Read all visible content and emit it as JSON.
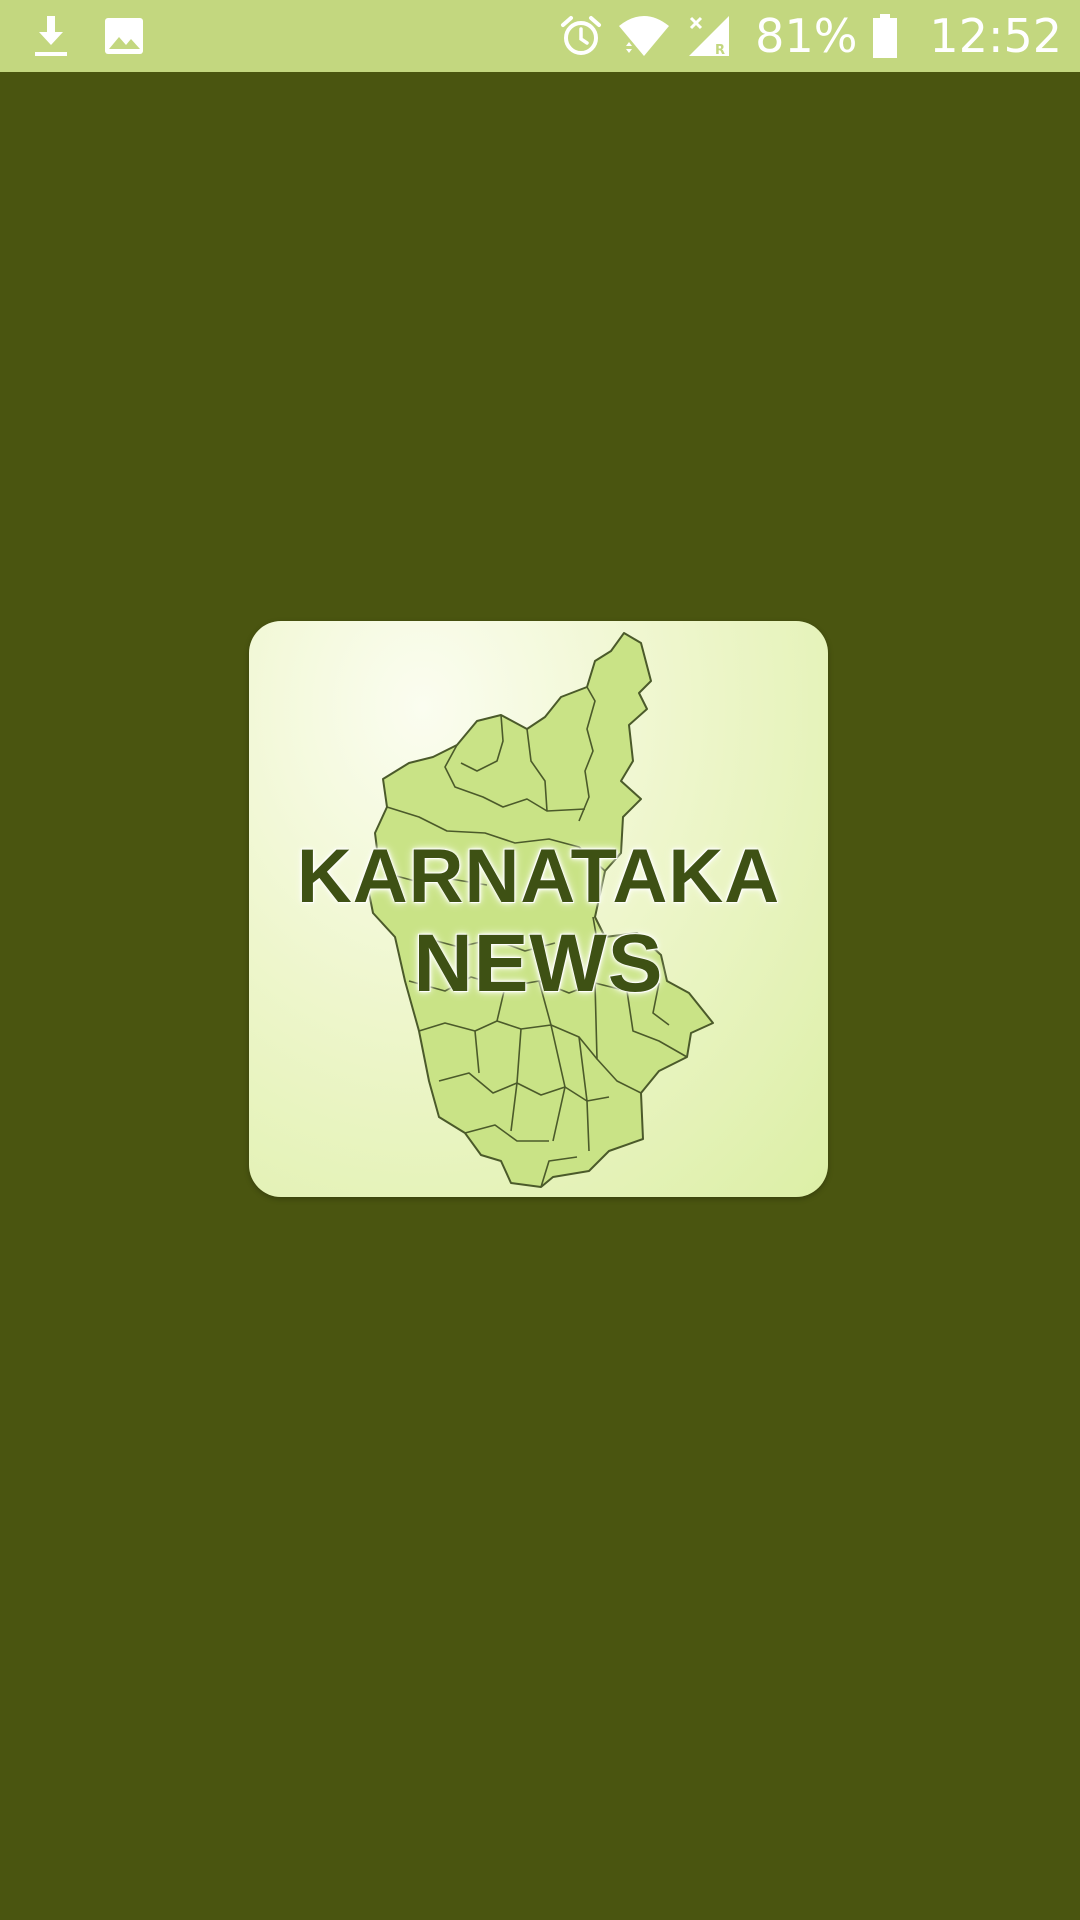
{
  "status_bar": {
    "left_icons": [
      "download-icon",
      "image-icon"
    ],
    "right_icons": [
      "alarm-icon",
      "wifi-icon",
      "signal-roaming-icon",
      "battery-icon"
    ],
    "battery_percent": "81%",
    "time": "12:52",
    "background": "#c3d77f"
  },
  "splash": {
    "background": "#4a5510",
    "logo": {
      "line1": "KARNATAKA",
      "line2": "NEWS",
      "text_color": "#3e5114",
      "map_fill": "#c9e386",
      "map_stroke": "#4b5a2a"
    }
  }
}
